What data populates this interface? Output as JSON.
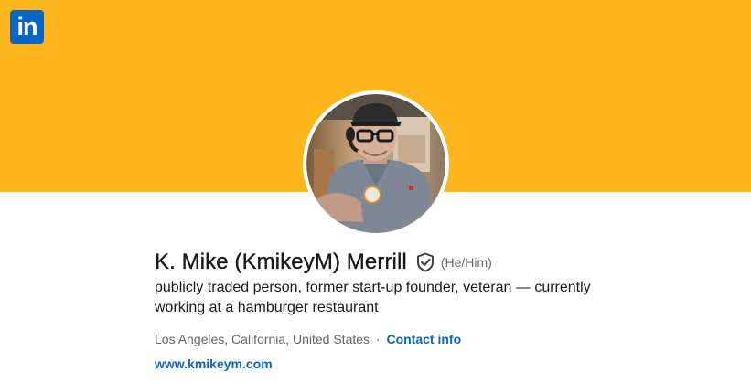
{
  "logo": {
    "text": "in",
    "icon": "linkedin-logo-icon",
    "color": "#0A66C2"
  },
  "banner": {
    "color": "#FDB71C"
  },
  "profile": {
    "name": "K. Mike (KmikeyM) Merrill",
    "verified_icon": "verified-shield-icon",
    "pronouns": "(He/Him)",
    "headline": "publicly traded person, former start-up founder, veteran — currently working at a hamburger restaurant",
    "location": "Los Angeles, California, United States",
    "separator": "·",
    "contact_label": "Contact info",
    "website": "www.kmikeym.com"
  },
  "colors": {
    "link": "#0A66C2",
    "text": "#191919",
    "muted": "#666666"
  }
}
